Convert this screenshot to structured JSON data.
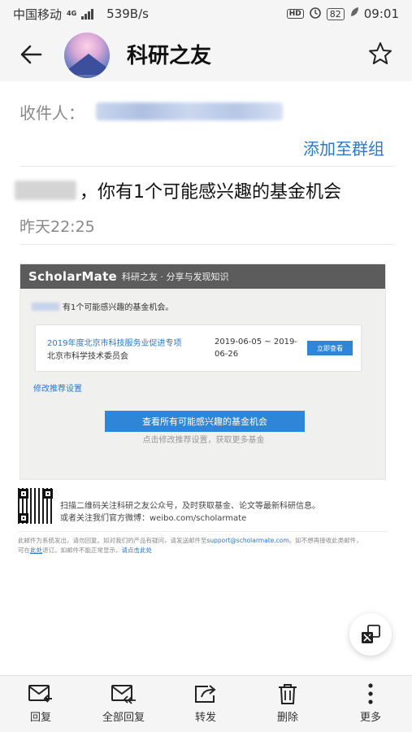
{
  "status_bar": {
    "carrier": "中国移动",
    "network": "4G",
    "speed": "539B/s",
    "hd": "HD",
    "battery": "82",
    "time": "09:01"
  },
  "header": {
    "sender_name": "科研之友"
  },
  "recipient": {
    "label": "收件人："
  },
  "add_group": "添加至群组",
  "subject": "，你有1个可能感兴趣的基金机会",
  "time": "昨天22:25",
  "email": {
    "brand": "ScholarMate",
    "brand_tagline": "科研之友 · 分享与发现知识",
    "intro": "有1个可能感兴趣的基金机会。",
    "fund": {
      "title": "2019年度北京市科技服务业促进专项",
      "org": "北京市科学技术委员会",
      "date": "2019-06-05 ~ 2019-06-26",
      "button": "立即查看"
    },
    "modify_link": "修改推荐设置",
    "cta_button": "查看所有可能感兴趣的基金机会",
    "cta_sub": "点击修改推荐设置，获取更多基金"
  },
  "footer": {
    "qr_line1": "扫描二维码关注科研之友公众号，及时获取基金、论文等最新科研信息。",
    "qr_line2": "或者关注我们官方微博：weibo.com/scholarmate",
    "fine_1": "此邮件为系统发出，请勿回复。如对我们的产品有疑问，请发送邮件至",
    "fine_email": "support@scholarmate.com",
    "fine_2": "。如不想再接收此类邮件，",
    "fine_3": "可在",
    "fine_here": "此处",
    "fine_4": "退订。如邮件不能正常显示，",
    "fine_click": "请点击此处"
  },
  "toolbar": {
    "reply": "回复",
    "reply_all": "全部回复",
    "forward": "转发",
    "delete": "删除",
    "more": "更多"
  }
}
